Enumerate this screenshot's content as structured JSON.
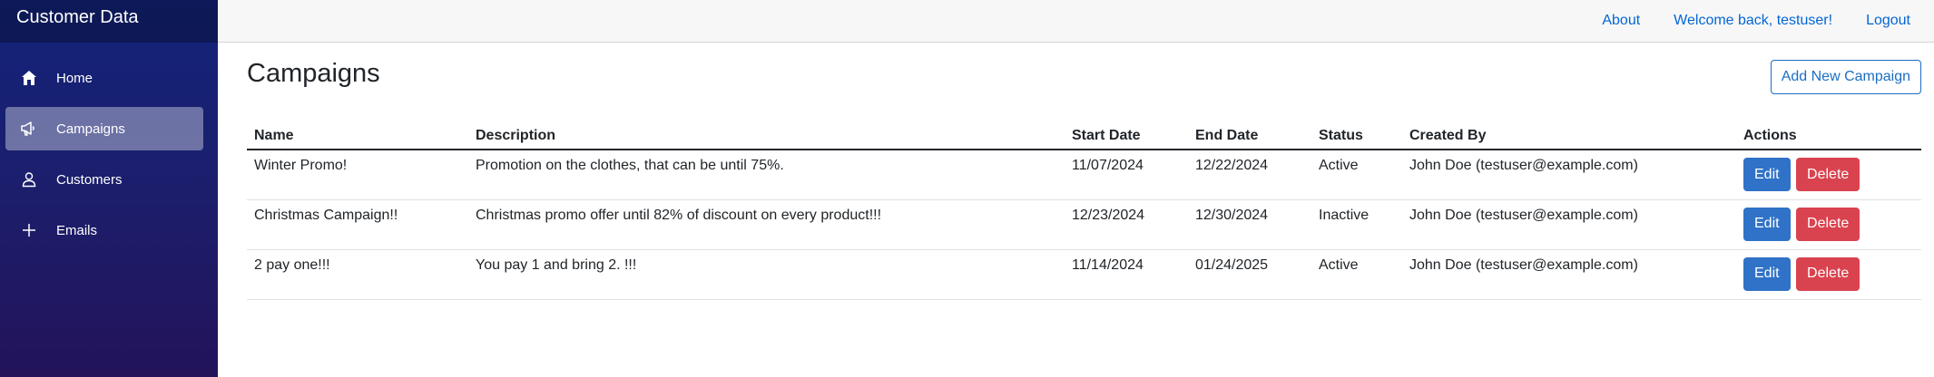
{
  "app": {
    "title": "Customer Data"
  },
  "sidebar": {
    "items": [
      {
        "label": "Home",
        "icon": "home-icon",
        "active": false
      },
      {
        "label": "Campaigns",
        "icon": "megaphone-icon",
        "active": true
      },
      {
        "label": "Customers",
        "icon": "person-icon",
        "active": false
      },
      {
        "label": "Emails",
        "icon": "plus-icon",
        "active": false
      }
    ]
  },
  "topbar": {
    "about": "About",
    "welcome": "Welcome back, testuser!",
    "logout": "Logout"
  },
  "page": {
    "title": "Campaigns",
    "add_button": "Add New Campaign"
  },
  "table": {
    "headers": [
      "Name",
      "Description",
      "Start Date",
      "End Date",
      "Status",
      "Created By",
      "Actions"
    ],
    "rows": [
      {
        "name": "Winter Promo!",
        "description": "Promotion on the clothes, that can be until 75%.",
        "start_date": "11/07/2024",
        "end_date": "12/22/2024",
        "status": "Active",
        "created_by": "John Doe (testuser@example.com)"
      },
      {
        "name": "Christmas Campaign!!",
        "description": "Christmas promo offer until 82% of discount on every product!!!",
        "start_date": "12/23/2024",
        "end_date": "12/30/2024",
        "status": "Inactive",
        "created_by": "John Doe (testuser@example.com)"
      },
      {
        "name": "2 pay one!!!",
        "description": "You pay 1 and bring 2. !!!",
        "start_date": "11/14/2024",
        "end_date": "01/24/2025",
        "status": "Active",
        "created_by": "John Doe (testuser@example.com)"
      }
    ],
    "edit_label": "Edit",
    "delete_label": "Delete"
  },
  "colors": {
    "link": "#0366d6",
    "edit": "#2f72c7",
    "delete": "#d9434f",
    "sidebar_top": "#12237a",
    "sidebar_bottom": "#23135a"
  }
}
